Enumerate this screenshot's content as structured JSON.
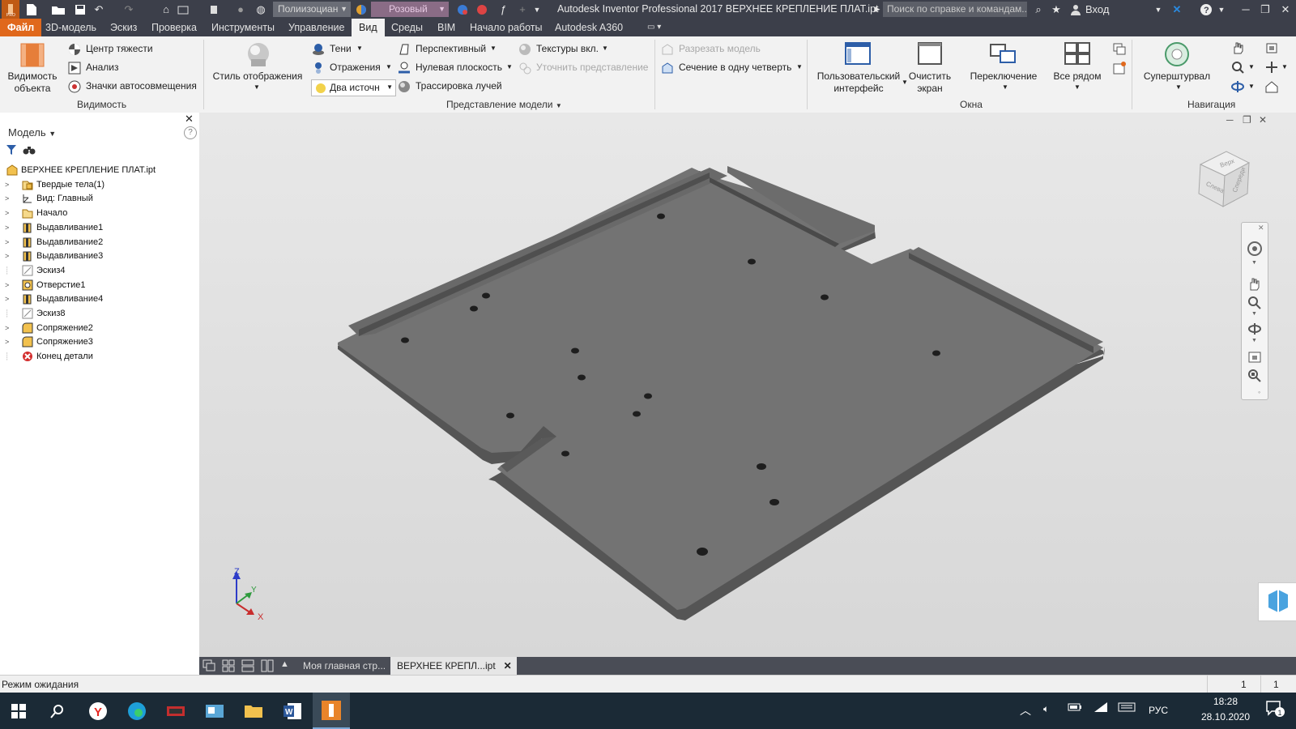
{
  "window": {
    "title": "Autodesk Inventor Professional 2017   ВЕРХНЕЕ КРЕПЛЕНИЕ ПЛАТ.ipt",
    "search_placeholder": "Поиск по справке и командам...",
    "sign_in": "Вход",
    "material_dropdown": "Полиизоциан",
    "appearance_dropdown": "Розовый"
  },
  "menu": {
    "tabs": [
      "Файл",
      "3D-модель",
      "Эскиз",
      "Проверка",
      "Инструменты",
      "Управление",
      "Вид",
      "Среды",
      "BIM",
      "Начало работы",
      "Autodesk A360"
    ],
    "active_tab": "Вид"
  },
  "ribbon": {
    "visibility": {
      "object_visibility": "Видимость объекта",
      "center_of_gravity": "Центр тяжести",
      "analysis": "Анализ",
      "autoalign_glyphs": "Значки автосовмещения",
      "title": "Видимость"
    },
    "appearance": {
      "visual_style": "Стиль отображения",
      "shadows": "Тени",
      "reflections": "Отражения",
      "two_lights": "Два источн",
      "perspective": "Перспективный",
      "ground_plane": "Нулевая плоскость",
      "ray_tracing": "Трассировка лучей",
      "textures_on": "Текстуры вкл.",
      "refine_view": "Уточнить представление",
      "half_section": "Разрезать модель",
      "quarter_section": "Сечение в одну четверть",
      "title": "Представление модели"
    },
    "windows": {
      "user_interface": "Пользовательский интерфейс",
      "clean_screen": "Очистить экран",
      "switch": "Переключение",
      "tile": "Все рядом",
      "title": "Окна"
    },
    "navigate": {
      "steering_wheel": "Суперштурвал",
      "title": "Навигация"
    }
  },
  "browser": {
    "title": "Модель",
    "items": [
      {
        "label": "ВЕРХНЕЕ КРЕПЛЕНИЕ ПЛАТ.ipt",
        "icon": "part-icon",
        "level": 0
      },
      {
        "label": "Твердые тела(1)",
        "icon": "solid-bodies-icon",
        "level": 1
      },
      {
        "label": "Вид: Главный",
        "icon": "view-rep-icon",
        "level": 1
      },
      {
        "label": "Начало",
        "icon": "origin-folder-icon",
        "level": 1
      },
      {
        "label": "Выдавливание1",
        "icon": "extrude-icon",
        "level": 1
      },
      {
        "label": "Выдавливание2",
        "icon": "extrude-icon",
        "level": 1
      },
      {
        "label": "Выдавливание3",
        "icon": "extrude-icon",
        "level": 1
      },
      {
        "label": "Эскиз4",
        "icon": "sketch-icon",
        "level": 1
      },
      {
        "label": "Отверстие1",
        "icon": "hole-icon",
        "level": 1
      },
      {
        "label": "Выдавливание4",
        "icon": "extrude-icon",
        "level": 1
      },
      {
        "label": "Эскиз8",
        "icon": "sketch-icon",
        "level": 1
      },
      {
        "label": "Сопряжение2",
        "icon": "fillet-icon",
        "level": 1
      },
      {
        "label": "Сопряжение3",
        "icon": "fillet-icon",
        "level": 1
      },
      {
        "label": "Конец детали",
        "icon": "end-of-part-icon",
        "level": 1
      }
    ]
  },
  "viewcube": {
    "top": "Верх",
    "front": "Спереди",
    "left": "Слева"
  },
  "triad": {
    "x": "X",
    "y": "Y",
    "z": "Z"
  },
  "doc_tabs": [
    "Моя главная стр...",
    "ВЕРХНЕЕ КРЕПЛ...ipt"
  ],
  "status": {
    "text": "Режим ожидания",
    "count1": "1",
    "count2": "1"
  },
  "taskbar": {
    "lang": "РУС",
    "time": "18:28",
    "date": "28.10.2020",
    "notifications": "1"
  },
  "colors": {
    "file_tab": "#e0681c",
    "title_bg": "#3c3f4a",
    "ribbon_bg": "#f2f2f2",
    "part_face": "#737373",
    "taskbar": "#1b2a36"
  }
}
